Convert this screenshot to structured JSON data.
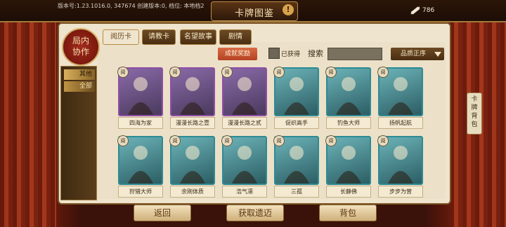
{
  "header": {
    "version_text": "版本号:1.23.1016.0, 347674   创建版本:0, 档位: 本地档2",
    "title": "卡牌图鉴",
    "info_label": "!",
    "currency_value": "786"
  },
  "emblem": {
    "line1": "局内",
    "line2": "协作"
  },
  "sidebar": {
    "items": [
      {
        "label": "其他"
      },
      {
        "label": "全部"
      }
    ]
  },
  "tabs": [
    {
      "label": "阅历卡",
      "active": true
    },
    {
      "label": "请教卡",
      "active": false
    },
    {
      "label": "名望故事",
      "active": false
    },
    {
      "label": "剧情",
      "active": false
    }
  ],
  "toolbar": {
    "reward_button": "成就奖励",
    "obtained_label": "已获得",
    "search_label": "搜索",
    "search_value": "",
    "sort_label": "品质正序"
  },
  "cards": [
    {
      "name": "四海为家",
      "badge": "阅",
      "rarity": "purple",
      "icon": "traveler-portrait-icon"
    },
    {
      "name": "漫漫长路之壹",
      "badge": "阅",
      "rarity": "purple",
      "icon": "road-landscape-icon"
    },
    {
      "name": "漫漫长路之贰",
      "badge": "阅",
      "rarity": "purple",
      "icon": "mountain-landscape-icon"
    },
    {
      "name": "促织高手",
      "badge": "阅",
      "rarity": "teal",
      "icon": "scholar-portrait-icon"
    },
    {
      "name": "钓鱼大师",
      "badge": "阅",
      "rarity": "teal",
      "icon": "fishing-icon"
    },
    {
      "name": "扬帆起航",
      "badge": "阅",
      "rarity": "teal",
      "icon": "sailing-ship-icon"
    },
    {
      "name": "狩猎大师",
      "badge": "阅",
      "rarity": "teal",
      "icon": "deer-icon"
    },
    {
      "name": "余刚体质",
      "badge": "阅",
      "rarity": "teal",
      "icon": "weapon-icon"
    },
    {
      "name": "浩气凛",
      "badge": "阅",
      "rarity": "teal",
      "icon": "official-portrait-icon"
    },
    {
      "name": "三孤",
      "badge": "阅",
      "rarity": "teal",
      "icon": "minister-portrait-icon"
    },
    {
      "name": "长静佛",
      "badge": "阅",
      "rarity": "teal",
      "icon": "lady-portrait-icon"
    },
    {
      "name": "步步为营",
      "badge": "阅",
      "rarity": "teal",
      "icon": "strategist-portrait-icon"
    }
  ],
  "side_tab": {
    "label": "卡牌背包"
  },
  "bottom": {
    "back": "返回",
    "obtain": "获取遗迈",
    "bag": "背包"
  },
  "colors": {
    "purple_frame": "#8f4ea8",
    "teal_frame": "#2d8b95",
    "accent_red": "#b44222"
  }
}
